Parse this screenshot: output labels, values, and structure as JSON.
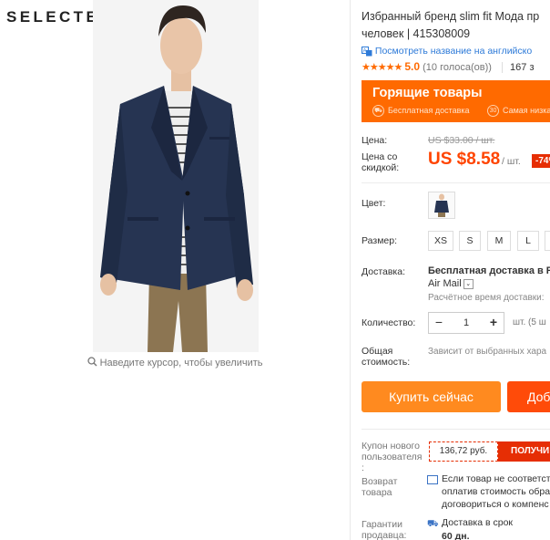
{
  "brand": "SELECTED",
  "zoom_hint": "Наведите курсор, чтобы увеличить",
  "product": {
    "title_line1": "Избранный бренд slim fit Мода пр",
    "title_line2": "человек | 415308009",
    "translate_link": "Посмотреть название на английско",
    "stars": "★★★★★",
    "rating": "5.0",
    "votes": "(10 голоса(ов))",
    "orders": "167 з"
  },
  "promo": {
    "title": "Горящие товары",
    "tag1": "Бесплатная доставка",
    "tag2": "Самая низка"
  },
  "price": {
    "label_price": "Цена:",
    "old": "US $33.00 / шт.",
    "label_discount_1": "Цена со",
    "label_discount_2": "скидкой:",
    "current": "US $8.58",
    "unit": "/ шт.",
    "discount": "-74%"
  },
  "options": {
    "color_label": "Цвет:",
    "size_label": "Размер:",
    "sizes": [
      "XS",
      "S",
      "M",
      "L",
      "X"
    ]
  },
  "shipping": {
    "label": "Доставка:",
    "main": "Бесплатная доставка в Ru",
    "method": "Air Mail",
    "time": "Расчётное время доставки:"
  },
  "quantity": {
    "label": "Количество:",
    "value": "1",
    "minus": "−",
    "plus": "+",
    "available": "шт. (5 ш"
  },
  "total": {
    "label_1": "Общая",
    "label_2": "стоимость:",
    "note": "Зависит от выбранных хара"
  },
  "buttons": {
    "buy": "Купить сейчас",
    "cart": "Доб"
  },
  "coupon": {
    "label_1": "Купон нового",
    "label_2": "пользователя",
    "label_3": ":",
    "amount": "136,72 руб.",
    "get": "ПОЛУЧИ"
  },
  "returns": {
    "label_1": "Возврат",
    "label_2": "товара",
    "line1": "Если товар не соответст",
    "line2": "оплатив стоимость обра",
    "line3": "договориться о компенс"
  },
  "guarantee": {
    "label_1": "Гарантии",
    "label_2": "продавца:",
    "line1": "Доставка в срок",
    "line2": "60 дн."
  },
  "colors": {
    "accent": "#ff6a00",
    "price": "#ff4400",
    "buy_button": "#ff8a1f",
    "cart_button": "#ff4b09",
    "link": "#2d7ad8",
    "jacket": "#263452",
    "pants": "#8c7552"
  }
}
